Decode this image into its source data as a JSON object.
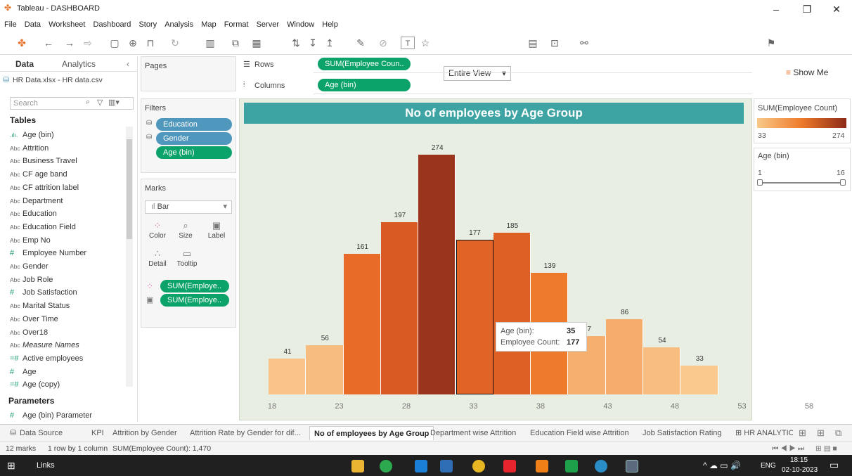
{
  "window": {
    "title": "Tableau - DASHBOARD"
  },
  "menu": [
    "File",
    "Data",
    "Worksheet",
    "Dashboard",
    "Story",
    "Analysis",
    "Map",
    "Format",
    "Server",
    "Window",
    "Help"
  ],
  "toolbar": {
    "view_mode": "Entire View",
    "show_me": "Show Me"
  },
  "data_pane": {
    "tabs": [
      "Data",
      "Analytics"
    ],
    "datasource": "HR Data.xlsx - HR data.csv",
    "search_placeholder": "Search",
    "tables_heading": "Tables",
    "fields": [
      {
        "type": "bin",
        "name": "Age (bin)"
      },
      {
        "type": "Abc",
        "name": "Attrition"
      },
      {
        "type": "Abc",
        "name": "Business Travel"
      },
      {
        "type": "Abc",
        "name": "CF age band"
      },
      {
        "type": "Abc",
        "name": "CF attrition label"
      },
      {
        "type": "Abc",
        "name": "Department"
      },
      {
        "type": "Abc",
        "name": "Education"
      },
      {
        "type": "Abc",
        "name": "Education Field"
      },
      {
        "type": "Abc",
        "name": "Emp No"
      },
      {
        "type": "#",
        "name": "Employee Number"
      },
      {
        "type": "Abc",
        "name": "Gender"
      },
      {
        "type": "Abc",
        "name": "Job Role"
      },
      {
        "type": "#",
        "name": "Job Satisfaction"
      },
      {
        "type": "Abc",
        "name": "Marital Status"
      },
      {
        "type": "Abc",
        "name": "Over Time"
      },
      {
        "type": "Abc",
        "name": "Over18"
      },
      {
        "type": "Abc",
        "name": "Measure Names"
      },
      {
        "type": "=#",
        "name": "Active employees"
      },
      {
        "type": "#",
        "name": "Age"
      },
      {
        "type": "=#",
        "name": "Age (copy)"
      }
    ],
    "parameters_heading": "Parameters",
    "parameters": [
      {
        "type": "#",
        "name": "Age (bin) Parameter"
      }
    ]
  },
  "pages_label": "Pages",
  "filters": {
    "label": "Filters",
    "pills": [
      "Education",
      "Gender",
      "Age (bin)"
    ]
  },
  "marks": {
    "label": "Marks",
    "type": "Bar",
    "buttons": [
      "Color",
      "Size",
      "Label",
      "Detail",
      "Tooltip"
    ],
    "pills": [
      "SUM(Employe..",
      "SUM(Employe.."
    ]
  },
  "rows": {
    "label": "Rows",
    "pill": "SUM(Employee Coun.."
  },
  "columns": {
    "label": "Columns",
    "pill": "Age (bin)"
  },
  "chart_data": {
    "type": "bar",
    "title": "No of employees by Age Group",
    "categories": [
      18,
      23,
      28,
      33,
      38,
      43,
      48,
      53,
      58
    ],
    "bars": [
      {
        "age": 18,
        "value": 41,
        "color": "#f9c48a"
      },
      {
        "age": 22,
        "value": 56,
        "color": "#f7bd7f"
      },
      {
        "age": 26,
        "value": 161,
        "color": "#e86b28"
      },
      {
        "age": 29,
        "value": 197,
        "color": "#d95a22"
      },
      {
        "age": 32,
        "value": 274,
        "color": "#9a341d"
      },
      {
        "age": 35,
        "value": 177,
        "color": "#e26326"
      },
      {
        "age": 38,
        "value": 185,
        "color": "#df6025"
      },
      {
        "age": 42,
        "value": 139,
        "color": "#ee7b2c"
      },
      {
        "age": 45,
        "value": 67,
        "color": "#f5b070"
      },
      {
        "age": 48,
        "value": 86,
        "color": "#f5ac6c"
      },
      {
        "age": 52,
        "value": 54,
        "color": "#f8bd80"
      },
      {
        "age": 55,
        "value": 33,
        "color": "#fac98d"
      }
    ],
    "ylim": [
      0,
      300
    ],
    "hovered_index": 5
  },
  "tooltip": {
    "field1": "Age (bin):",
    "value1": "35",
    "field2": "Employee Count:",
    "value2": "177"
  },
  "legend": {
    "color_title": "SUM(Employee Count)",
    "min": "33",
    "max": "274",
    "filter_title": "Age (bin)",
    "filter_min": "1",
    "filter_max": "16"
  },
  "sheet_tabs": [
    "Data Source",
    "KPI",
    "Attrition by Gender",
    "Attrition Rate by Gender for dif...",
    "No of employees by Age Group",
    "Department wise Attrition",
    "Education Field wise Attrition",
    "Job Satisfaction Rating",
    "HR ANALYTIC"
  ],
  "status": {
    "marks": "12 marks",
    "dims": "1 row by 1 column",
    "sum": "SUM(Employee Count): 1,470"
  },
  "taskbar": {
    "links": "Links",
    "lang": "ENG",
    "time": "18:15",
    "date": "02-10-2023"
  }
}
